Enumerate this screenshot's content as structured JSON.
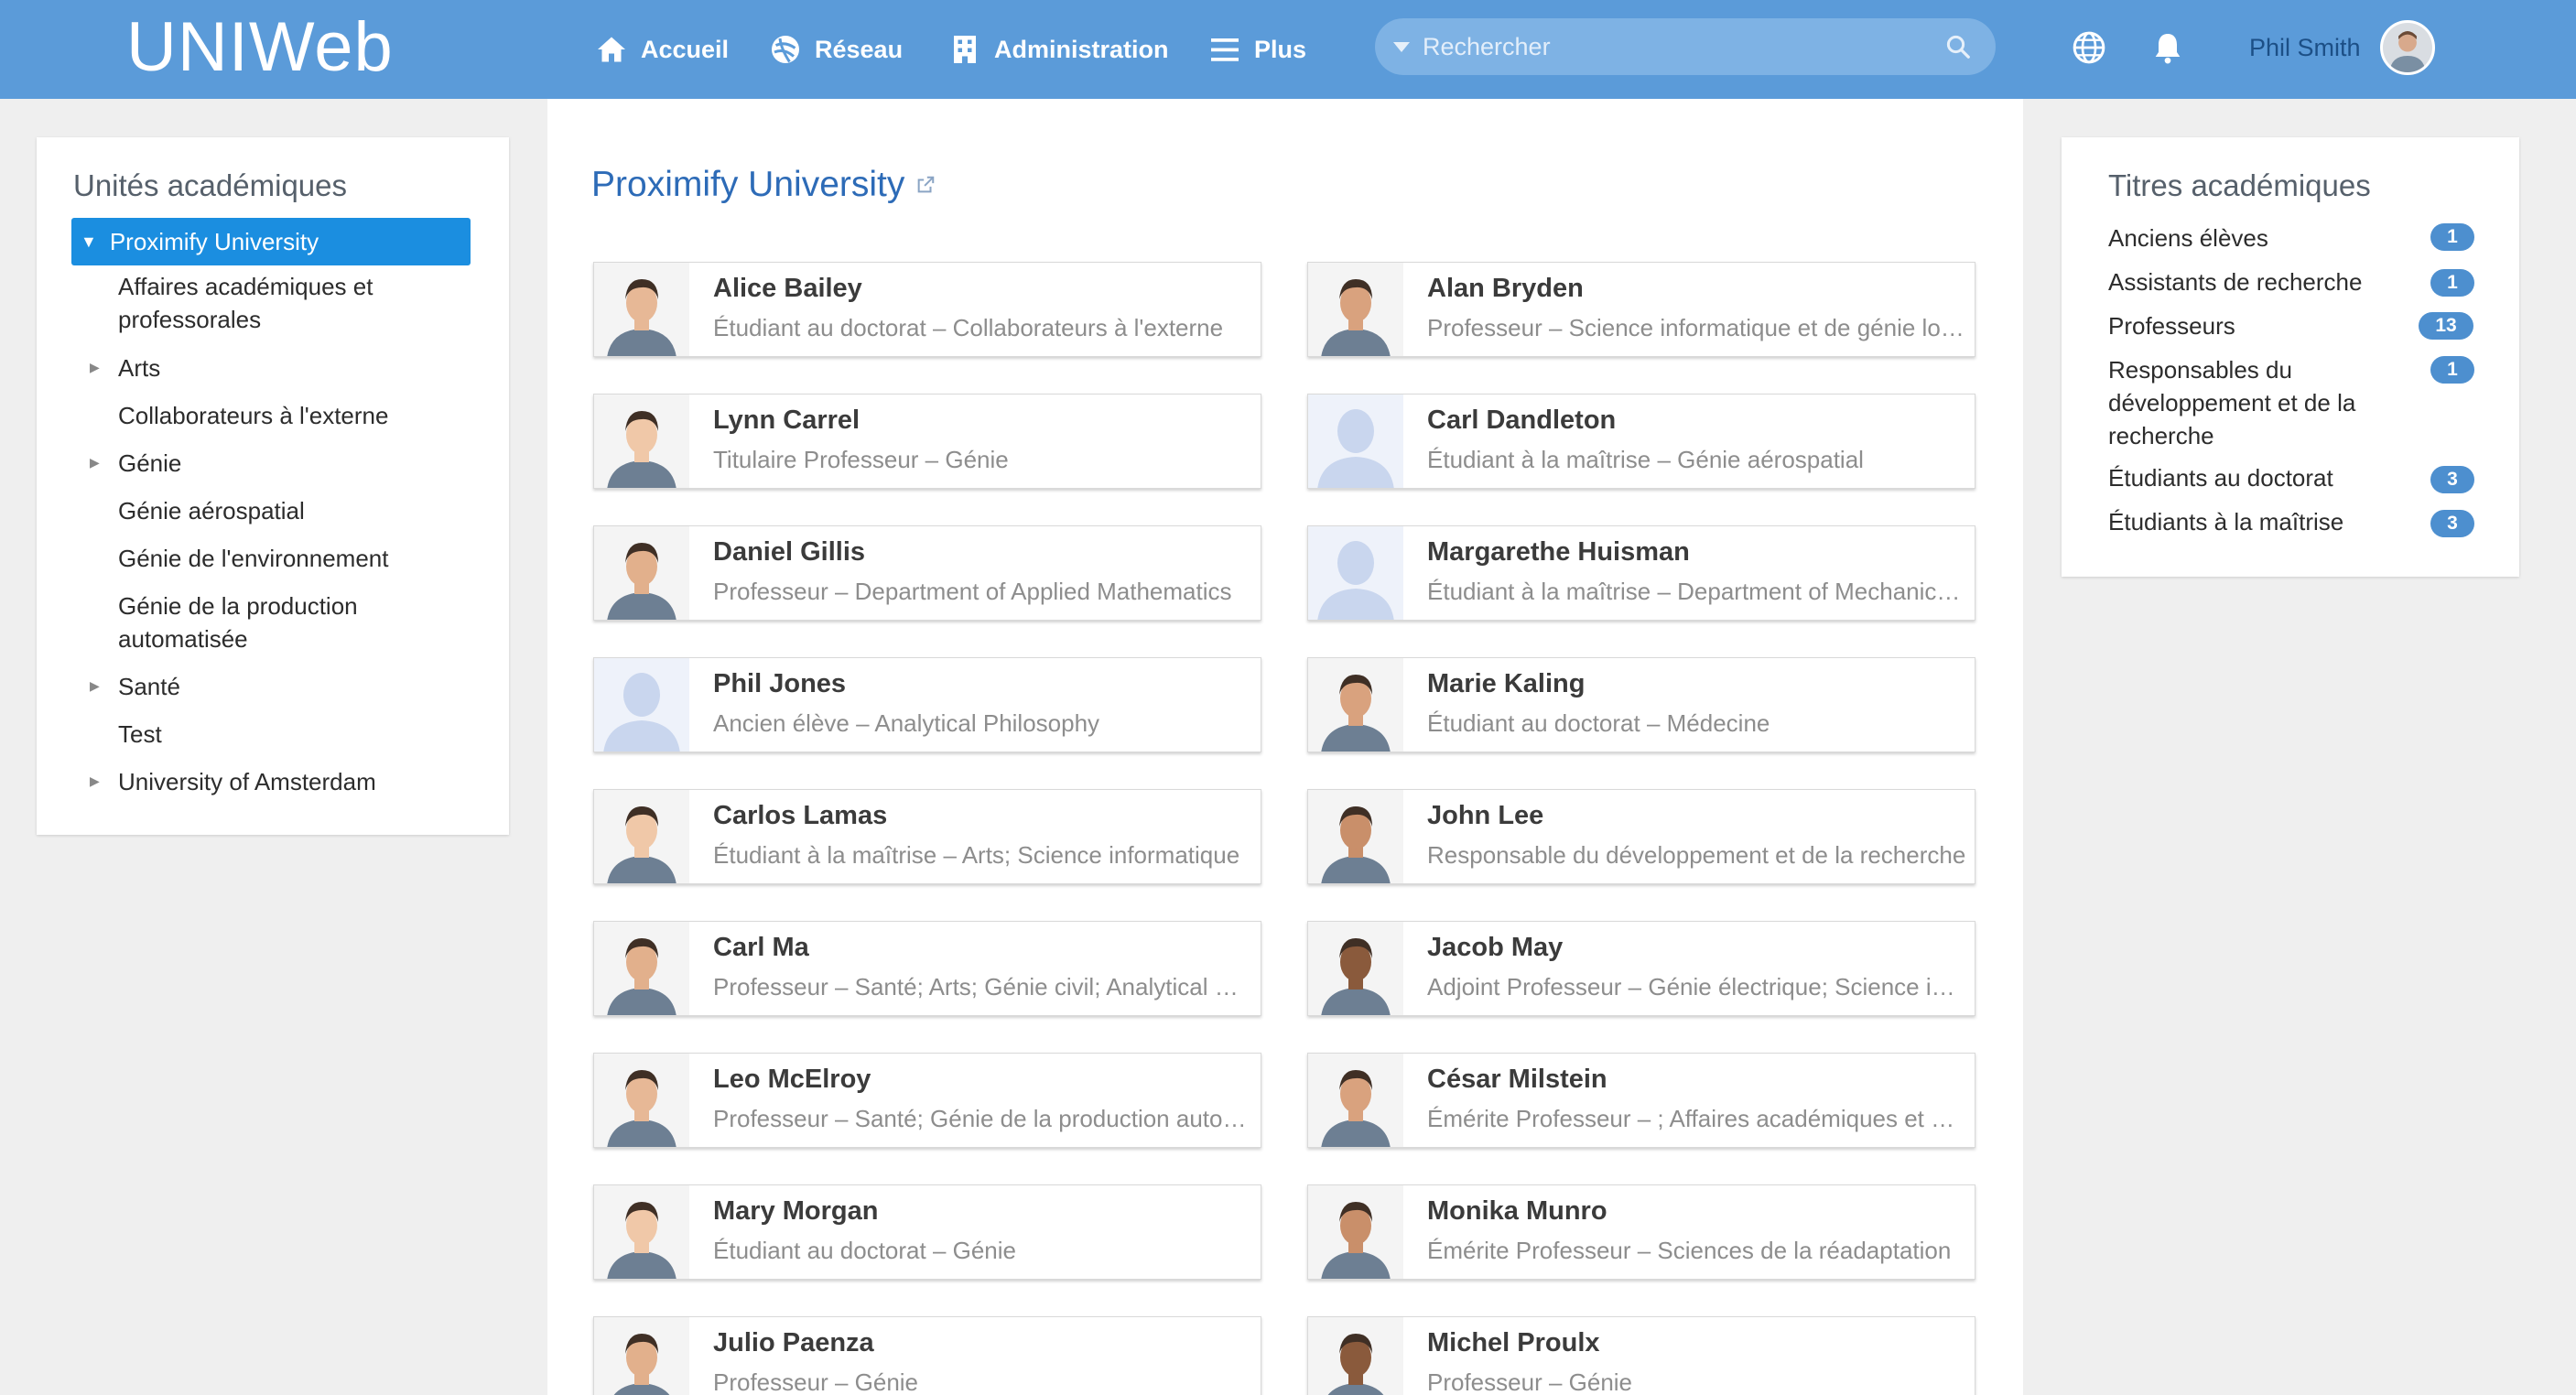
{
  "app": {
    "logo": "UNIWeb"
  },
  "nav": {
    "items": [
      {
        "label": "Accueil",
        "icon": "home-icon"
      },
      {
        "label": "Réseau",
        "icon": "network-icon"
      },
      {
        "label": "Administration",
        "icon": "building-icon"
      },
      {
        "label": "Plus",
        "icon": "menu-icon"
      }
    ],
    "search_placeholder": "Rechercher",
    "user_name": "Phil Smith"
  },
  "left_panel": {
    "title": "Unités académiques",
    "selected": "Proximify University",
    "items": [
      {
        "label": "Affaires académiques et professorales",
        "expandable": false
      },
      {
        "label": "Arts",
        "expandable": true
      },
      {
        "label": "Collaborateurs à l'externe",
        "expandable": false
      },
      {
        "label": "Génie",
        "expandable": true
      },
      {
        "label": "Génie aérospatial",
        "expandable": false
      },
      {
        "label": "Génie de l'environnement",
        "expandable": false
      },
      {
        "label": "Génie de la production automatisée",
        "expandable": false
      },
      {
        "label": "Santé",
        "expandable": true
      },
      {
        "label": "Test",
        "expandable": false
      },
      {
        "label": "University of Amsterdam",
        "expandable": true
      }
    ]
  },
  "main": {
    "title": "Proximify University",
    "people": [
      {
        "name": "Alice Bailey",
        "subtitle": "Étudiant au doctorat – Collaborateurs à l'externe",
        "photo": true
      },
      {
        "name": "Alan Bryden",
        "subtitle": "Professeur – Science informatique et de génie logiciel",
        "photo": true
      },
      {
        "name": "Lynn Carrel",
        "subtitle": "Titulaire Professeur – Génie",
        "photo": true
      },
      {
        "name": "Carl Dandleton",
        "subtitle": "Étudiant à la maîtrise – Génie aérospatial",
        "photo": false
      },
      {
        "name": "Daniel Gillis",
        "subtitle": "Professeur – Department of Applied Mathematics",
        "photo": true
      },
      {
        "name": "Margarethe Huisman",
        "subtitle": "Étudiant à la maîtrise – Department of Mechanical Engineering",
        "photo": false
      },
      {
        "name": "Phil Jones",
        "subtitle": "Ancien élève – Analytical Philosophy",
        "photo": false
      },
      {
        "name": "Marie Kaling",
        "subtitle": "Étudiant au doctorat – Médecine",
        "photo": true
      },
      {
        "name": "Carlos Lamas",
        "subtitle": "Étudiant à la maîtrise – Arts; Science informatique",
        "photo": true
      },
      {
        "name": "John Lee",
        "subtitle": "Responsable du développement et de la recherche",
        "photo": true
      },
      {
        "name": "Carl Ma",
        "subtitle": "Professeur – Santé; Arts; Génie civil; Analytical Philosophy",
        "photo": true
      },
      {
        "name": "Jacob May",
        "subtitle": "Adjoint Professeur – Génie électrique; Science informatique",
        "photo": true
      },
      {
        "name": "Leo McElroy",
        "subtitle": "Professeur – Santé; Génie de la production automatisée",
        "photo": true
      },
      {
        "name": "César Milstein",
        "subtitle": "Émérite Professeur – ; Affaires académiques et professorales",
        "photo": true
      },
      {
        "name": "Mary Morgan",
        "subtitle": "Étudiant au doctorat – Génie",
        "photo": true
      },
      {
        "name": "Monika Munro",
        "subtitle": "Émérite Professeur – Sciences de la réadaptation",
        "photo": true
      },
      {
        "name": "Julio Paenza",
        "subtitle": "Professeur – Génie",
        "photo": true
      },
      {
        "name": "Michel Proulx",
        "subtitle": "Professeur – Génie",
        "photo": true
      }
    ]
  },
  "right_panel": {
    "title": "Titres académiques",
    "items": [
      {
        "label": "Anciens élèves",
        "count": "1"
      },
      {
        "label": "Assistants de recherche",
        "count": "1"
      },
      {
        "label": "Professeurs",
        "count": "13"
      },
      {
        "label": "Responsables du développement et de la recherche",
        "count": "1"
      },
      {
        "label": "Étudiants au doctorat",
        "count": "3"
      },
      {
        "label": "Étudiants à la maîtrise",
        "count": "3"
      }
    ]
  },
  "colors": {
    "topbar": "#5b9bd9",
    "accent": "#1b8ee0",
    "badge": "#4d8fcf",
    "title": "#2d6bb7"
  }
}
